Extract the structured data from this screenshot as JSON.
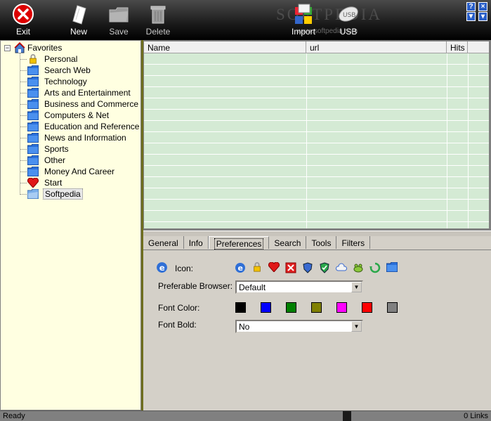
{
  "toolbar": {
    "exit_label": "Exit",
    "new_label": "New",
    "save_label": "Save",
    "delete_label": "Delete",
    "import_label": "Import",
    "usb_label": "USB",
    "usb_badge": "USB",
    "watermark": "SOFTPEDIA",
    "watermark_url": "www.softpedia.com",
    "help_glyph": "?",
    "close_glyph": "×",
    "menu_glyph": "▼",
    "minimize_glyph": "▾"
  },
  "tree": {
    "root_label": "Favorites",
    "expander": "−",
    "items": [
      {
        "label": "Personal",
        "icon": "lock-icon"
      },
      {
        "label": "Search Web",
        "icon": "folder-icon"
      },
      {
        "label": "Technology",
        "icon": "folder-icon"
      },
      {
        "label": "Arts and Entertainment",
        "icon": "folder-icon"
      },
      {
        "label": "Business and Commerce",
        "icon": "folder-icon"
      },
      {
        "label": "Computers & Net",
        "icon": "folder-icon"
      },
      {
        "label": "Education and Reference",
        "icon": "folder-icon"
      },
      {
        "label": "News and Information",
        "icon": "folder-icon"
      },
      {
        "label": "Sports",
        "icon": "folder-icon"
      },
      {
        "label": "Other",
        "icon": "folder-icon"
      },
      {
        "label": "Money And Career",
        "icon": "folder-icon"
      },
      {
        "label": "Start",
        "icon": "heart-icon"
      },
      {
        "label": "Softpedia",
        "icon": "folder-open-icon",
        "selected": true
      }
    ]
  },
  "grid": {
    "columns": [
      "Name",
      "url",
      "Hits"
    ]
  },
  "tabs": [
    "General",
    "Info",
    "Preferences",
    "Search",
    "Tools",
    "Filters"
  ],
  "active_tab": "Preferences",
  "preferences": {
    "icon_label": "Icon:",
    "browser_label": "Preferable Browser:",
    "browser_value": "Default",
    "font_color_label": "Font Color:",
    "font_bold_label": "Font Bold:",
    "font_bold_value": "No",
    "font_colors": [
      "#000000",
      "#0000ff",
      "#008000",
      "#808000",
      "#ff00ff",
      "#ff0000",
      "#808080"
    ],
    "icon_options": [
      "ie-icon",
      "lock-icon",
      "heart-icon",
      "close-icon",
      "shield-icon",
      "shield-check-icon",
      "cloud-icon",
      "frog-icon",
      "recycle-icon",
      "folder-icon"
    ]
  },
  "status": {
    "text": "Ready",
    "count": "0 Links"
  }
}
